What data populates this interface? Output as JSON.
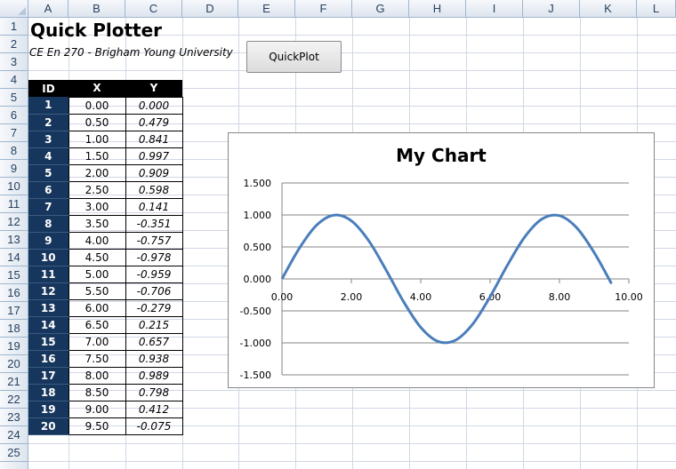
{
  "sheet": {
    "columns": [
      "A",
      "B",
      "C",
      "D",
      "E",
      "F",
      "G",
      "H",
      "I",
      "J",
      "K",
      "L"
    ],
    "rows": [
      "1",
      "2",
      "3",
      "4",
      "5",
      "6",
      "7",
      "8",
      "9",
      "10",
      "11",
      "12",
      "13",
      "14",
      "15",
      "16",
      "17",
      "18",
      "19",
      "20",
      "21",
      "22",
      "23",
      "24",
      "25"
    ]
  },
  "title": "Quick Plotter",
  "subtitle": "CE En 270 - Brigham Young University",
  "quickplot_label": "QuickPlot",
  "table": {
    "headers": [
      "ID",
      "X",
      "Y"
    ],
    "rows": [
      [
        "1",
        "0.00",
        "0.000"
      ],
      [
        "2",
        "0.50",
        "0.479"
      ],
      [
        "3",
        "1.00",
        "0.841"
      ],
      [
        "4",
        "1.50",
        "0.997"
      ],
      [
        "5",
        "2.00",
        "0.909"
      ],
      [
        "6",
        "2.50",
        "0.598"
      ],
      [
        "7",
        "3.00",
        "0.141"
      ],
      [
        "8",
        "3.50",
        "-0.351"
      ],
      [
        "9",
        "4.00",
        "-0.757"
      ],
      [
        "10",
        "4.50",
        "-0.978"
      ],
      [
        "11",
        "5.00",
        "-0.959"
      ],
      [
        "12",
        "5.50",
        "-0.706"
      ],
      [
        "13",
        "6.00",
        "-0.279"
      ],
      [
        "14",
        "6.50",
        "0.215"
      ],
      [
        "15",
        "7.00",
        "0.657"
      ],
      [
        "16",
        "7.50",
        "0.938"
      ],
      [
        "17",
        "8.00",
        "0.989"
      ],
      [
        "18",
        "8.50",
        "0.798"
      ],
      [
        "19",
        "9.00",
        "0.412"
      ],
      [
        "20",
        "9.50",
        "-0.075"
      ]
    ]
  },
  "chart_data": {
    "type": "line",
    "title": "My Chart",
    "x": [
      0,
      0.5,
      1,
      1.5,
      2,
      2.5,
      3,
      3.5,
      4,
      4.5,
      5,
      5.5,
      6,
      6.5,
      7,
      7.5,
      8,
      8.5,
      9,
      9.5
    ],
    "series": [
      {
        "values": [
          0,
          0.479,
          0.841,
          0.997,
          0.909,
          0.598,
          0.141,
          -0.351,
          -0.757,
          -0.978,
          -0.959,
          -0.706,
          -0.279,
          0.215,
          0.657,
          0.938,
          0.989,
          0.798,
          0.412,
          -0.075
        ]
      }
    ],
    "xlim": [
      0,
      10
    ],
    "ylim": [
      -1.5,
      1.5
    ],
    "xticks": [
      "0.00",
      "2.00",
      "4.00",
      "6.00",
      "8.00",
      "10.00"
    ],
    "yticks": [
      "1.500",
      "1.000",
      "0.500",
      "0.000",
      "-0.500",
      "-1.000",
      "-1.500"
    ],
    "grid": true,
    "line_color": "#4a7ebb",
    "smooth": true
  }
}
